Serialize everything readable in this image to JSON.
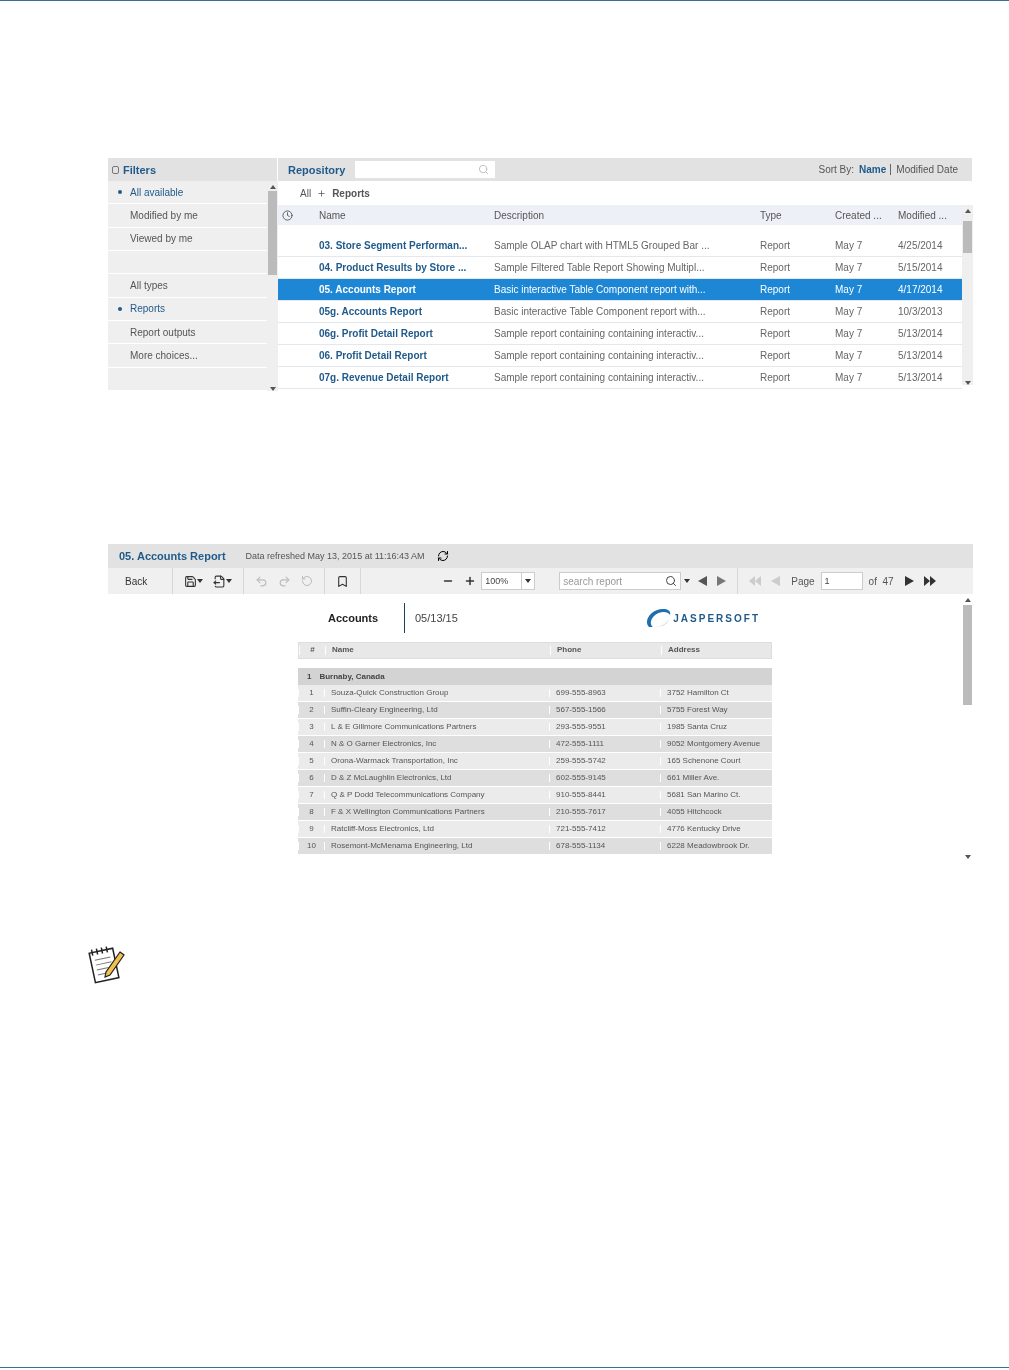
{
  "filters": {
    "title": "Filters",
    "groups": [
      {
        "items": [
          {
            "label": "All available",
            "selected": true
          },
          {
            "label": "Modified by me",
            "selected": false
          },
          {
            "label": "Viewed by me",
            "selected": false
          }
        ]
      },
      {
        "items": [
          {
            "label": "All types",
            "selected": false
          },
          {
            "label": "Reports",
            "selected": true
          },
          {
            "label": "Report outputs",
            "selected": false
          },
          {
            "label": "More choices...",
            "selected": false
          }
        ]
      }
    ]
  },
  "repository": {
    "title": "Repository",
    "sort_label": "Sort By:",
    "sort_options": [
      {
        "label": "Name",
        "selected": true
      },
      {
        "label": "Modified Date",
        "selected": false
      }
    ],
    "breadcrumb": [
      "All",
      "Reports"
    ],
    "columns": [
      "Name",
      "Description",
      "Type",
      "Created ...",
      "Modified ..."
    ],
    "rows": [
      {
        "name": "03. Store Segment Performan...",
        "description": "Sample OLAP chart with HTML5 Grouped Bar ...",
        "type": "Report",
        "created": "May 7",
        "modified": "4/25/2014",
        "selected": false
      },
      {
        "name": "04. Product Results by Store ...",
        "description": "Sample Filtered Table Report Showing Multipl...",
        "type": "Report",
        "created": "May 7",
        "modified": "5/15/2014",
        "selected": false
      },
      {
        "name": "05. Accounts Report",
        "description": "Basic interactive Table Component report with...",
        "type": "Report",
        "created": "May 7",
        "modified": "4/17/2014",
        "selected": true
      },
      {
        "name": "05g. Accounts Report",
        "description": "Basic interactive Table Component report with...",
        "type": "Report",
        "created": "May 7",
        "modified": "10/3/2013",
        "selected": false
      },
      {
        "name": "06g. Profit Detail Report",
        "description": "Sample report containing containing interactiv...",
        "type": "Report",
        "created": "May 7",
        "modified": "5/13/2014",
        "selected": false
      },
      {
        "name": "06. Profit Detail Report",
        "description": "Sample report containing containing interactiv...",
        "type": "Report",
        "created": "May 7",
        "modified": "5/13/2014",
        "selected": false
      },
      {
        "name": "07g. Revenue Detail Report",
        "description": "Sample report containing containing interactiv...",
        "type": "Report",
        "created": "May 7",
        "modified": "5/13/2014",
        "selected": false
      }
    ]
  },
  "viewer": {
    "title": "05. Accounts Report",
    "refreshed": "Data refreshed May 13, 2015 at 11:16:43 AM",
    "toolbar": {
      "back": "Back",
      "zoom": "100%",
      "search_placeholder": "search report",
      "page_label": "Page",
      "page_value": "1",
      "page_count": "of  47"
    },
    "report": {
      "title": "Accounts",
      "date": "05/13/15",
      "logo": "JASPERSOFT",
      "columns": [
        "#",
        "Name",
        "Phone",
        "Address"
      ],
      "group": {
        "index": "1",
        "label": "Burnaby, Canada"
      },
      "rows": [
        [
          "1",
          "Souza-Quick Construction Group",
          "699-555-8963",
          "3752 Hamilton Ct"
        ],
        [
          "2",
          "Suffin-Cleary Engineering, Ltd",
          "567-555-1566",
          "5755 Forest Way"
        ],
        [
          "3",
          "L & E Gillmore Communications Partners",
          "293-555-9551",
          "1985 Santa Cruz"
        ],
        [
          "4",
          "N & O Garner Electronics, Inc",
          "472-555-1111",
          "9052 Montgomery Avenue"
        ],
        [
          "5",
          "Orona-Warmack Transportation, Inc",
          "259-555-5742",
          "165 Schenone Court"
        ],
        [
          "6",
          "D & Z McLaughlin Electronics, Ltd",
          "602-555-9145",
          "661 Miller Ave."
        ],
        [
          "7",
          "Q & P Dodd Telecommunications Company",
          "910-555-8441",
          "5681 San Marino Ct."
        ],
        [
          "8",
          "F & X Wellington Communications Partners",
          "210-555-7617",
          "4055 Hitchcock"
        ],
        [
          "9",
          "Ratcliff-Moss Electronics, Ltd",
          "721-555-7412",
          "4776 Kentucky Drive"
        ],
        [
          "10",
          "Rosemont-McMenama Engineering, Ltd",
          "678-555-1134",
          "6228 Meadowbrook Dr."
        ]
      ]
    }
  }
}
